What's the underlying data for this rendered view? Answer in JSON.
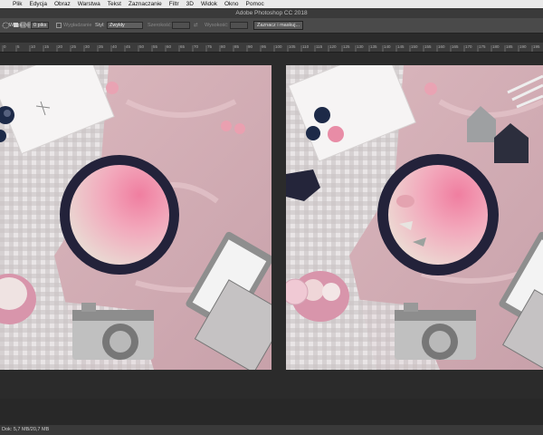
{
  "menu": {
    "items": [
      "Plik",
      "Edycja",
      "Obraz",
      "Warstwa",
      "Tekst",
      "Zaznaczanie",
      "Filtr",
      "3D",
      "Widok",
      "Okno",
      "Pomoc"
    ]
  },
  "window": {
    "title": "Adobe Photoshop CC 2018"
  },
  "options": {
    "feather_label": "Wtapianie:",
    "feather_value": "0 piks",
    "antialias_label": "Wygładzanie",
    "style_label": "Styl:",
    "style_value": "Zwykły",
    "width_label": "Szerokość:",
    "height_label": "Wysokość:",
    "select_mask_button": "Zaznacz i maskuj..."
  },
  "ruler": {
    "ticks": [
      "0",
      "5",
      "10",
      "15",
      "20",
      "25",
      "30",
      "35",
      "40",
      "45",
      "50",
      "55",
      "60",
      "65",
      "70",
      "75",
      "80",
      "85",
      "90",
      "95",
      "100",
      "105",
      "110",
      "115",
      "120",
      "125",
      "130",
      "135",
      "140",
      "145",
      "150",
      "155",
      "160",
      "165",
      "170",
      "175",
      "180",
      "185",
      "190",
      "195"
    ]
  },
  "status": {
    "text": "Dok: 5,7 MB/20,7 MB"
  },
  "colors": {
    "accent_pink": "#f0a0b8",
    "frame_navy": "#23223a",
    "fabric_pink": "#d9b4bb"
  }
}
